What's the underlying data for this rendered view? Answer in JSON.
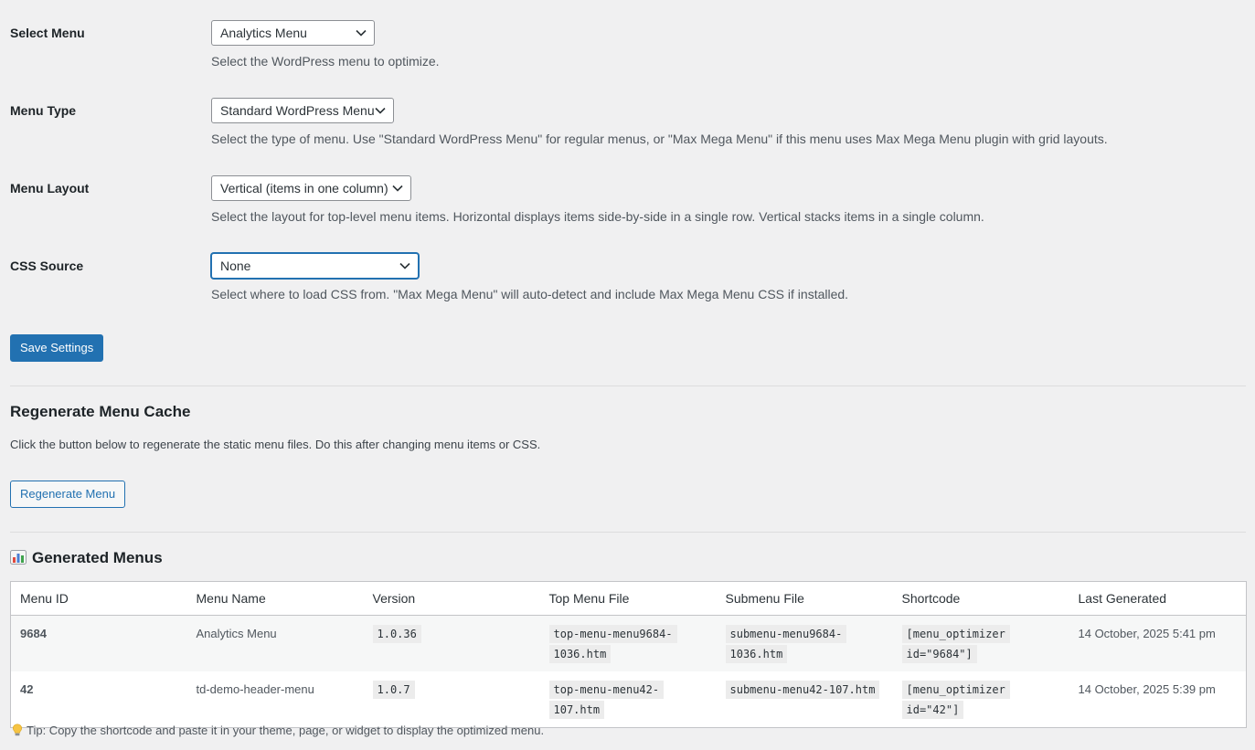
{
  "settings": {
    "select_menu": {
      "label": "Select Menu",
      "value": "Analytics Menu",
      "description": "Select the WordPress menu to optimize."
    },
    "menu_type": {
      "label": "Menu Type",
      "value": "Standard WordPress Menu",
      "description": "Select the type of menu. Use \"Standard WordPress Menu\" for regular menus, or \"Max Mega Menu\" if this menu uses Max Mega Menu plugin with grid layouts."
    },
    "menu_layout": {
      "label": "Menu Layout",
      "value": "Vertical (items in one column)",
      "description": "Select the layout for top-level menu items. Horizontal displays items side-by-side in a single row. Vertical stacks items in a single column."
    },
    "css_source": {
      "label": "CSS Source",
      "value": "None",
      "description": "Select where to load CSS from. \"Max Mega Menu\" will auto-detect and include Max Mega Menu CSS if installed."
    },
    "save_label": "Save Settings"
  },
  "regenerate": {
    "title": "Regenerate Menu Cache",
    "description": "Click the button below to regenerate the static menu files. Do this after changing menu items or CSS.",
    "button_label": "Regenerate Menu"
  },
  "generated": {
    "title": "Generated Menus",
    "icon": "bar-chart-icon",
    "columns": [
      "Menu ID",
      "Menu Name",
      "Version",
      "Top Menu File",
      "Submenu File",
      "Shortcode",
      "Last Generated"
    ],
    "rows": [
      {
        "id": "9684",
        "name": "Analytics Menu",
        "version": "1.0.36",
        "top_file": "top-menu-menu9684-1036.htm",
        "sub_file": "submenu-menu9684-1036.htm",
        "shortcode": "[menu_optimizer id=\"9684\"]",
        "last_generated": "14 October, 2025 5:41 pm"
      },
      {
        "id": "42",
        "name": "td-demo-header-menu",
        "version": "1.0.7",
        "top_file": "top-menu-menu42-107.htm",
        "sub_file": "submenu-menu42-107.htm",
        "shortcode": "[menu_optimizer id=\"42\"]",
        "last_generated": "14 October, 2025 5:39 pm"
      }
    ],
    "tip": "Tip: Copy the shortcode and paste it in your theme, page, or widget to display the optimized menu."
  },
  "colors": {
    "accent": "#2271b1",
    "background": "#f0f0f1",
    "border": "#c3c4c7"
  }
}
